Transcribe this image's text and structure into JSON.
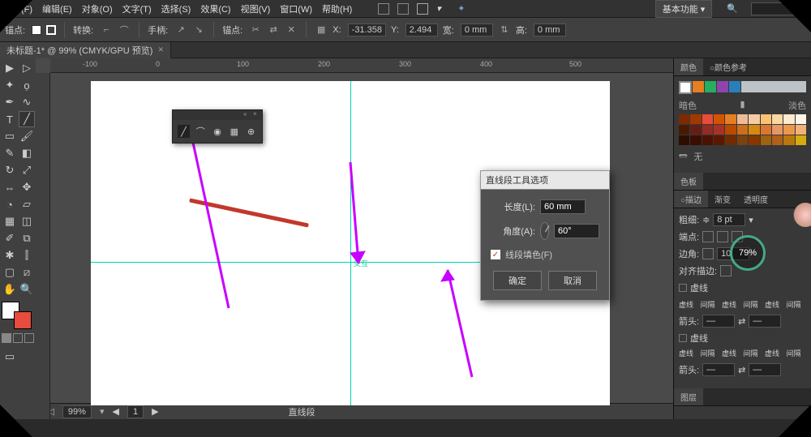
{
  "menu": {
    "file": "文件(F)",
    "edit": "编辑(E)",
    "object": "对象(O)",
    "text": "文字(T)",
    "select": "选择(S)",
    "effect": "效果(C)",
    "view": "视图(V)",
    "window": "窗口(W)",
    "help": "帮助(H)",
    "basic": "基本功能"
  },
  "ctrl": {
    "anchor": "锚点:",
    "convert": "转换:",
    "handle": "手柄:",
    "anchors": "锚点:",
    "x": "X:",
    "xv": "-31.358",
    "y": "Y:",
    "yv": "2.494",
    "w": "宽:",
    "wv": "0 mm",
    "h": "高:",
    "hv": "0 mm"
  },
  "tab": {
    "name": "未标题-1* @ 99% (CMYK/GPU 预览)"
  },
  "ruler": {
    "m100": "-100",
    "p0": "0",
    "p100": "100",
    "p200": "200",
    "p300": "300",
    "p400": "400",
    "p500": "500"
  },
  "dialog": {
    "title": "直线段工具选项",
    "length": "长度(L):",
    "lenv": "60 mm",
    "angle": "角度(A):",
    "angv": "60°",
    "fill": "线段填色(F)",
    "ok": "确定",
    "cancel": "取消"
  },
  "panels": {
    "color": "颜色",
    "colorref": "○颜色参考",
    "dark": "暗色",
    "light": "淡色",
    "none": "无",
    "swatch": "色板",
    "stroke": "○描边",
    "grad": "渐变",
    "opacity": "透明度",
    "weight": "粗细:",
    "weightv": "8 pt",
    "cap": "端点:",
    "corner": "边角:",
    "cornerv": "10",
    "align": "对齐描边:",
    "dashed": "虚线",
    "dash": "虚线",
    "gap": "间隔",
    "arrow": "箭头:",
    "layers": "图层"
  },
  "status": {
    "zoom": "99%",
    "nav": "1",
    "tool": "直线段",
    "mark": "交互"
  },
  "pct": "79%",
  "tools_icons": {
    "lasso": "❐"
  }
}
